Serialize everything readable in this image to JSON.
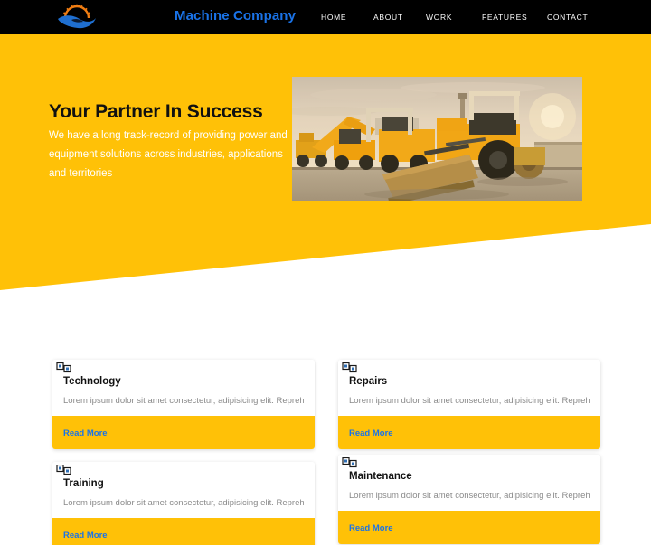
{
  "navbar": {
    "logo_icon": "gear-swoosh-logo",
    "brand": "Machine Company",
    "links": [
      {
        "label": "HOME"
      },
      {
        "label": "ABOUT"
      },
      {
        "label": "WORK"
      },
      {
        "label": "FEATURES"
      },
      {
        "label": "CONTACT"
      }
    ]
  },
  "hero": {
    "title": "Your Partner In Success",
    "copy": "We have a long track-record of providing power and equipment solutions across industries, applications and territories",
    "image_alt": "construction-machinery-bulldozer-grader",
    "background_color": "#ffc107"
  },
  "cards": [
    {
      "icon": "broken-image-icon",
      "title": "Technology",
      "text": "Lorem ipsum dolor sit amet consectetur, adipisicing elit. Reprehenderit",
      "link": "Read More"
    },
    {
      "icon": "broken-image-icon",
      "title": "Repairs",
      "text": "Lorem ipsum dolor sit amet consectetur, adipisicing elit. Reprehenderit",
      "link": "Read More"
    },
    {
      "icon": "broken-image-icon",
      "title": "Training",
      "text": "Lorem ipsum dolor sit amet consectetur, adipisicing elit. Reprehenderit",
      "link": "Read More"
    },
    {
      "icon": "broken-image-icon",
      "title": "Maintenance",
      "text": "Lorem ipsum dolor sit amet consectetur, adipisicing elit. Reprehenderit",
      "link": "Read More"
    }
  ],
  "colors": {
    "accent_yellow": "#ffc107",
    "brand_blue": "#1a73e8",
    "nav_black": "#000000",
    "logo_orange": "#f07d12"
  }
}
